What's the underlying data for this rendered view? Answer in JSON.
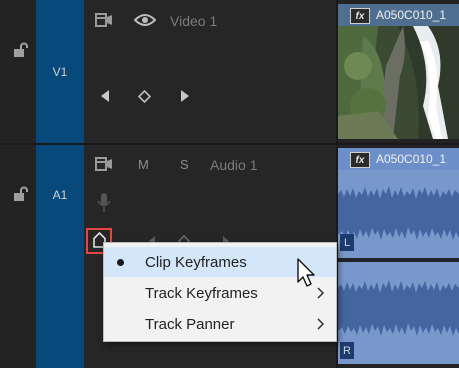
{
  "tracks": {
    "video": {
      "label": "V1",
      "name": "Video 1",
      "clip": {
        "name": "A050C010_1",
        "fx": "fx"
      }
    },
    "audio": {
      "label": "A1",
      "mute": "M",
      "solo": "S",
      "name": "Audio 1",
      "clip": {
        "name": "A050C010_1",
        "fx": "fx",
        "left_channel": "L",
        "right_channel": "R"
      }
    }
  },
  "context_menu": {
    "items": [
      {
        "label": "Clip Keyframes",
        "checked": true,
        "submenu": false,
        "highlighted": true
      },
      {
        "label": "Track Keyframes",
        "checked": false,
        "submenu": true,
        "highlighted": false
      },
      {
        "label": "Track Panner",
        "checked": false,
        "submenu": true,
        "highlighted": false
      }
    ]
  },
  "colors": {
    "track_tag": "#06497a",
    "video_clip_header": "#4e6f8f",
    "audio_clip": "#7898cc",
    "highlight_box": "#e84545",
    "menu_highlight": "#d4e6fa"
  }
}
